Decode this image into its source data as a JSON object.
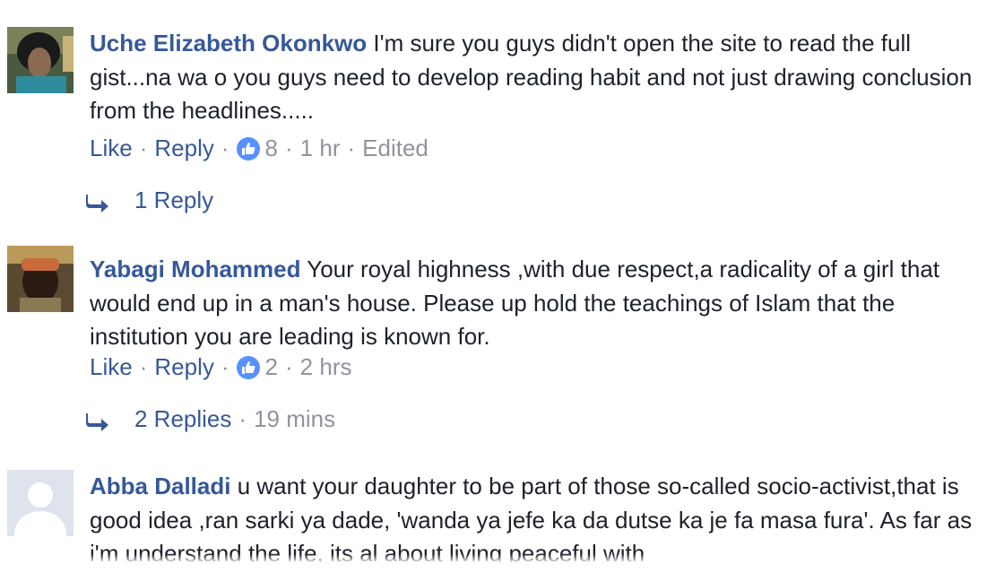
{
  "comments": [
    {
      "author": "Uche Elizabeth Okonkwo",
      "text": "I'm sure you guys didn't open the site to read the full gist...na wa o you guys need to develop reading habit and not just drawing conclusion from the headlines.....",
      "like_label": "Like",
      "reply_label": "Reply",
      "like_count": "8",
      "time": "1 hr",
      "edited": "Edited",
      "replies_label": "1 Reply",
      "replies_time": ""
    },
    {
      "author": "Yabagi Mohammed",
      "text": "Your royal highness ,with due respect,a radicality of a girl that would end up in a man's house. Please up hold the teachings of Islam that the institution you are leading is known for.",
      "like_label": "Like",
      "reply_label": "Reply",
      "like_count": "2",
      "time": "2 hrs",
      "edited": "",
      "replies_label": "2 Replies",
      "replies_time": "19 mins"
    },
    {
      "author": "Abba Dalladi",
      "text": "u want your daughter to be part of those so-called socio-activist,that is good idea ,ran sarki ya dade, 'wanda ya jefe ka da dutse ka je fa masa fura'. As far as i'm understand the life, its al about living peaceful with",
      "like_label": "",
      "reply_label": "",
      "like_count": "",
      "time": "",
      "edited": "",
      "replies_label": "",
      "replies_time": ""
    }
  ],
  "separator": "·",
  "icons": {
    "like": "thumbs-up-icon",
    "reply_arrow": "reply-arrow-icon",
    "default_avatar": "default-avatar-icon"
  },
  "colors": {
    "author": "#365899",
    "meta": "#90949c",
    "like_badge": "#5890ff",
    "text": "#1d2129"
  }
}
